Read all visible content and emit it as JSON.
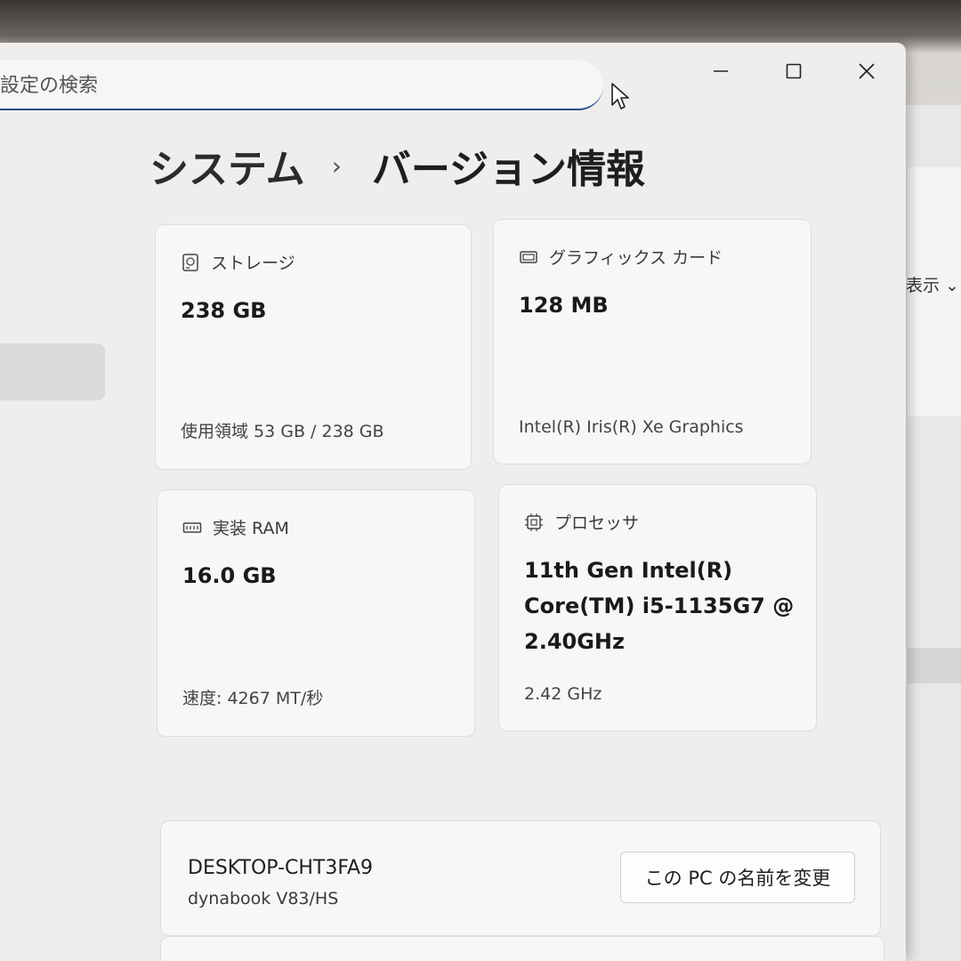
{
  "search": {
    "placeholder": "設定の検索"
  },
  "breadcrumb": {
    "parent": "システム",
    "separator": "›",
    "current": "バージョン情報"
  },
  "cards": {
    "storage": {
      "icon": "hard-drive-icon",
      "title": "ストレージ",
      "value": "238 GB",
      "sub": "使用領域 53 GB / 238 GB"
    },
    "graphics": {
      "icon": "graphics-card-icon",
      "title": "グラフィックス カード",
      "value": "128 MB",
      "sub": "Intel(R) Iris(R) Xe Graphics"
    },
    "ram": {
      "icon": "memory-icon",
      "title": "実装 RAM",
      "value": "16.0 GB",
      "sub": "速度: 4267 MT/秒"
    },
    "processor": {
      "icon": "cpu-chip-icon",
      "title": "プロセッサ",
      "value_lines": [
        "11th Gen Intel(R)",
        "Core(TM) i5-1135G7 @",
        "2.40GHz"
      ],
      "sub": "2.42 GHz"
    }
  },
  "device": {
    "name": "DESKTOP-CHT3FA9",
    "model": "dynabook V83/HS",
    "rename_label": "この PC の名前を変更"
  },
  "background_window": {
    "label": "表示 ⌄"
  }
}
